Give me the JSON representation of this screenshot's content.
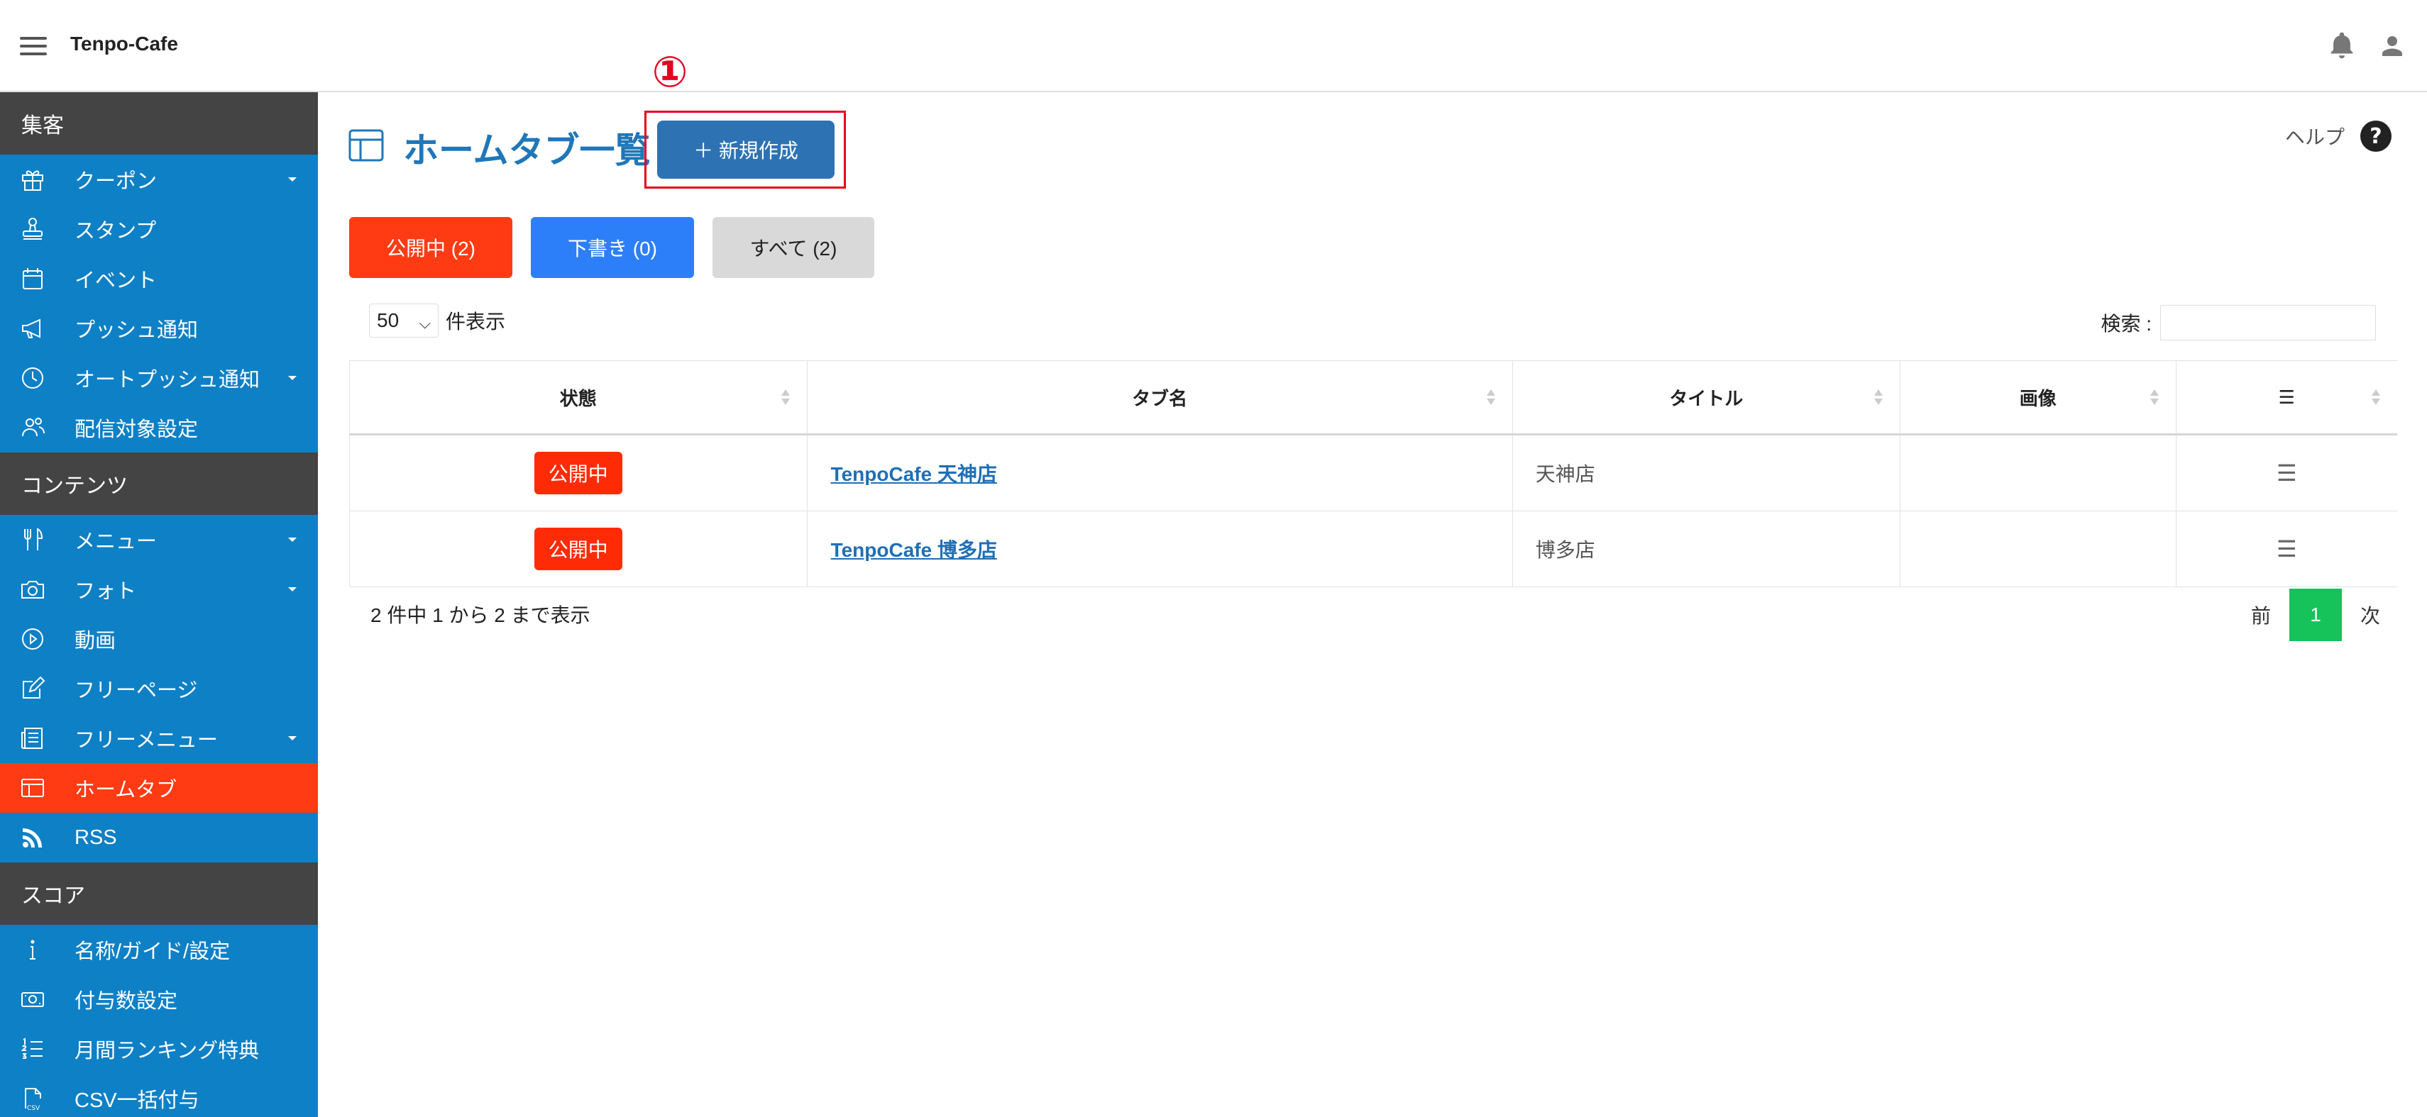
{
  "app": {
    "title": "Tenpo-Cafe"
  },
  "sidebar": {
    "sections": [
      {
        "title": "集客",
        "items": [
          {
            "label": "クーポン",
            "icon": "gift-icon",
            "caret": true
          },
          {
            "label": "スタンプ",
            "icon": "stamp-icon",
            "caret": false
          },
          {
            "label": "イベント",
            "icon": "calendar-icon",
            "caret": false
          },
          {
            "label": "プッシュ通知",
            "icon": "megaphone-icon",
            "caret": false
          },
          {
            "label": "オートプッシュ通知",
            "icon": "clock-icon",
            "caret": true
          },
          {
            "label": "配信対象設定",
            "icon": "users-icon",
            "caret": false
          }
        ]
      },
      {
        "title": "コンテンツ",
        "items": [
          {
            "label": "メニュー",
            "icon": "fork-knife-icon",
            "caret": true
          },
          {
            "label": "フォト",
            "icon": "camera-icon",
            "caret": true
          },
          {
            "label": "動画",
            "icon": "play-circle-icon",
            "caret": false
          },
          {
            "label": "フリーページ",
            "icon": "edit-icon",
            "caret": false
          },
          {
            "label": "フリーメニュー",
            "icon": "newspaper-icon",
            "caret": true
          },
          {
            "label": "ホームタブ",
            "icon": "layout-icon",
            "caret": false,
            "active": true
          },
          {
            "label": "RSS",
            "icon": "rss-icon",
            "caret": false
          }
        ]
      },
      {
        "title": "スコア",
        "items": [
          {
            "label": "名称/ガイド/設定",
            "icon": "info-icon",
            "caret": false
          },
          {
            "label": "付与数設定",
            "icon": "money-icon",
            "caret": false
          },
          {
            "label": "月間ランキング特典",
            "icon": "ranking-list-icon",
            "caret": false
          },
          {
            "label": "CSV一括付与",
            "icon": "csv-file-icon",
            "caret": false
          }
        ]
      }
    ]
  },
  "main": {
    "title": "ホームタブ一覧",
    "new_button": "＋ 新規作成",
    "annotation_number": "①",
    "help": "ヘルプ",
    "filters": [
      {
        "label": "公開中 (2)"
      },
      {
        "label": "下書き (0)"
      },
      {
        "label": "すべて (2)"
      }
    ],
    "page_length": {
      "value": "50",
      "suffix": "件表示"
    },
    "search": {
      "label": "検索 :",
      "value": ""
    },
    "table": {
      "headers": [
        "状態",
        "タブ名",
        "タイトル",
        "画像",
        "☰"
      ],
      "rows": [
        {
          "status": "公開中",
          "tab_name": "TenpoCafe 天神店",
          "title": "天神店",
          "image": "",
          "menu": "☰"
        },
        {
          "status": "公開中",
          "tab_name": "TenpoCafe 博多店",
          "title": "博多店",
          "image": "",
          "menu": "☰"
        }
      ]
    },
    "info": "2 件中 1 から 2 まで表示",
    "pagination": {
      "prev": "前",
      "current": "1",
      "next": "次"
    }
  },
  "colors": {
    "sidebar_bg": "#0e80c6",
    "section_bg": "#444444",
    "active_bg": "#ff3b13",
    "title_blue": "#1f77b8",
    "new_button": "#2d73b4",
    "draft_blue": "#2d7ff9",
    "published_red": "#ff2b06",
    "page_green": "#15c35a",
    "annotation_red": "#e6001e"
  }
}
